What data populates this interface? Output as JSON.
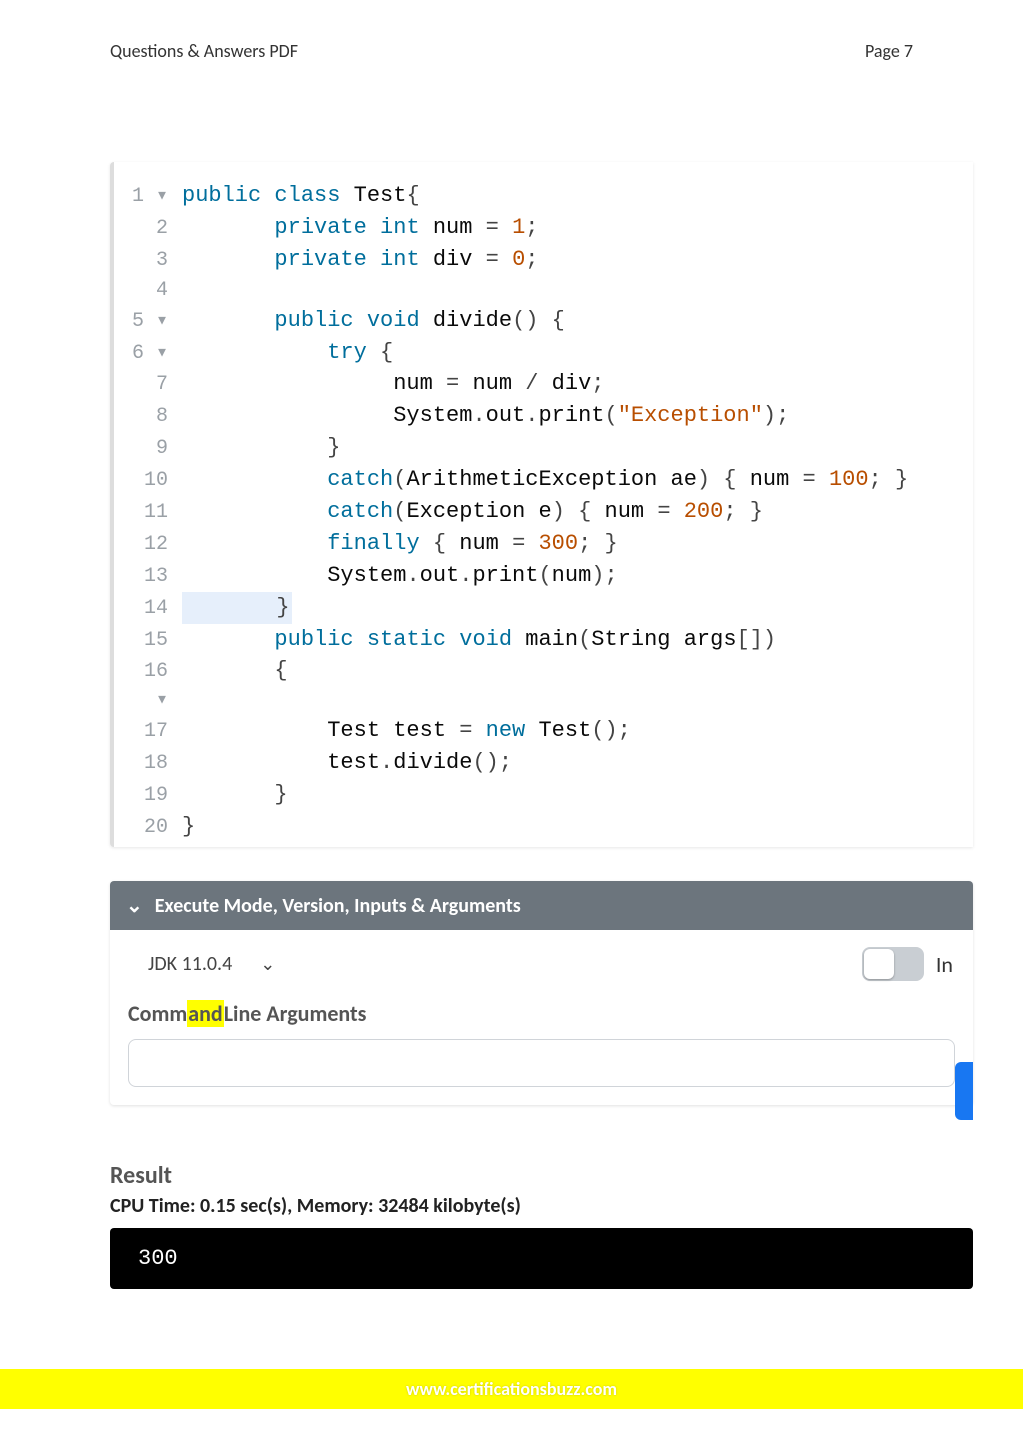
{
  "header": {
    "left": "Questions & Answers PDF",
    "right": "Page 7"
  },
  "code": {
    "lines": [
      {
        "ln": "1",
        "marker": "▾",
        "tokens": [
          [
            "k",
            "public "
          ],
          [
            "k",
            "class "
          ],
          [
            "nm",
            "Test"
          ],
          [
            "pn",
            "{"
          ]
        ]
      },
      {
        "ln": "2",
        "marker": "",
        "tokens": [
          [
            "nm",
            "       "
          ],
          [
            "k",
            "private "
          ],
          [
            "ty",
            "int "
          ],
          [
            "nm",
            "num "
          ],
          [
            "pn",
            "= "
          ],
          [
            "num",
            "1"
          ],
          [
            "pn",
            ";"
          ]
        ]
      },
      {
        "ln": "3",
        "marker": "",
        "tokens": [
          [
            "nm",
            "       "
          ],
          [
            "k",
            "private "
          ],
          [
            "ty",
            "int "
          ],
          [
            "nm",
            "div "
          ],
          [
            "pn",
            "= "
          ],
          [
            "num",
            "0"
          ],
          [
            "pn",
            ";"
          ]
        ]
      },
      {
        "ln": "4",
        "marker": "",
        "tokens": [
          [
            "nm",
            ""
          ]
        ]
      },
      {
        "ln": "5",
        "marker": "▾",
        "tokens": [
          [
            "nm",
            "       "
          ],
          [
            "k",
            "public "
          ],
          [
            "ty",
            "void "
          ],
          [
            "nm",
            "divide"
          ],
          [
            "pn",
            "() {"
          ]
        ]
      },
      {
        "ln": "6",
        "marker": "▾",
        "tokens": [
          [
            "nm",
            "           "
          ],
          [
            "k",
            "try "
          ],
          [
            "pn",
            "{"
          ]
        ]
      },
      {
        "ln": "7",
        "marker": "",
        "tokens": [
          [
            "nm",
            "                num "
          ],
          [
            "pn",
            "= "
          ],
          [
            "nm",
            "num "
          ],
          [
            "pn",
            "/ "
          ],
          [
            "nm",
            "div"
          ],
          [
            "pn",
            ";"
          ]
        ]
      },
      {
        "ln": "8",
        "marker": "",
        "tokens": [
          [
            "nm",
            "                System"
          ],
          [
            "pn",
            "."
          ],
          [
            "nm",
            "out"
          ],
          [
            "pn",
            "."
          ],
          [
            "nm",
            "print"
          ],
          [
            "pn",
            "("
          ],
          [
            "str",
            "\"Exception\""
          ],
          [
            "pn",
            ");"
          ]
        ]
      },
      {
        "ln": "9",
        "marker": "",
        "tokens": [
          [
            "nm",
            "           "
          ],
          [
            "pn",
            "}"
          ]
        ]
      },
      {
        "ln": "10",
        "marker": "",
        "tokens": [
          [
            "nm",
            "           "
          ],
          [
            "k",
            "catch"
          ],
          [
            "pn",
            "("
          ],
          [
            "nm",
            "ArithmeticException ae"
          ],
          [
            "pn",
            ") { "
          ],
          [
            "nm",
            "num "
          ],
          [
            "pn",
            "= "
          ],
          [
            "num",
            "100"
          ],
          [
            "pn",
            "; }"
          ]
        ]
      },
      {
        "ln": "11",
        "marker": "",
        "tokens": [
          [
            "nm",
            "           "
          ],
          [
            "k",
            "catch"
          ],
          [
            "pn",
            "("
          ],
          [
            "nm",
            "Exception e"
          ],
          [
            "pn",
            ") { "
          ],
          [
            "nm",
            "num "
          ],
          [
            "pn",
            "= "
          ],
          [
            "num",
            "200"
          ],
          [
            "pn",
            "; }"
          ]
        ]
      },
      {
        "ln": "12",
        "marker": "",
        "tokens": [
          [
            "nm",
            "           "
          ],
          [
            "k",
            "finally "
          ],
          [
            "pn",
            "{ "
          ],
          [
            "nm",
            "num "
          ],
          [
            "pn",
            "= "
          ],
          [
            "num",
            "300"
          ],
          [
            "pn",
            "; }"
          ]
        ]
      },
      {
        "ln": "13",
        "marker": "",
        "tokens": [
          [
            "nm",
            "           System"
          ],
          [
            "pn",
            "."
          ],
          [
            "nm",
            "out"
          ],
          [
            "pn",
            "."
          ],
          [
            "nm",
            "print"
          ],
          [
            "pn",
            "("
          ],
          [
            "nm",
            "num"
          ],
          [
            "pn",
            ");"
          ]
        ]
      },
      {
        "ln": "14",
        "marker": "",
        "tokens": [
          [
            "nm",
            "       "
          ],
          [
            "pn",
            "}"
          ]
        ],
        "hl": true
      },
      {
        "ln": "15",
        "marker": "",
        "tokens": [
          [
            "nm",
            "       "
          ],
          [
            "k",
            "public "
          ],
          [
            "k",
            "static "
          ],
          [
            "ty",
            "void "
          ],
          [
            "nm",
            "main"
          ],
          [
            "pn",
            "("
          ],
          [
            "nm",
            "String args"
          ],
          [
            "pn",
            "[])"
          ]
        ]
      },
      {
        "ln": "16",
        "marker": "▾",
        "tokens": [
          [
            "nm",
            "       "
          ],
          [
            "pn",
            "{"
          ]
        ]
      },
      {
        "ln": "17",
        "marker": "",
        "tokens": [
          [
            "nm",
            "           Test test "
          ],
          [
            "pn",
            "= "
          ],
          [
            "k",
            "new "
          ],
          [
            "nm",
            "Test"
          ],
          [
            "pn",
            "();"
          ]
        ]
      },
      {
        "ln": "18",
        "marker": "",
        "tokens": [
          [
            "nm",
            "           test"
          ],
          [
            "pn",
            "."
          ],
          [
            "nm",
            "divide"
          ],
          [
            "pn",
            "();"
          ]
        ]
      },
      {
        "ln": "19",
        "marker": "",
        "tokens": [
          [
            "nm",
            "       "
          ],
          [
            "pn",
            "}"
          ]
        ]
      },
      {
        "ln": "20",
        "marker": "",
        "tokens": [
          [
            "pn",
            "}"
          ]
        ],
        "hlend": true
      }
    ]
  },
  "settings": {
    "title": "Execute Mode, Version, Inputs & Arguments",
    "jdk": "JDK 11.0.4",
    "toggleLabel": "In",
    "cmdPrefix": "Comm",
    "cmdHighlight": "and",
    "cmdSuffix": "Line Arguments"
  },
  "result": {
    "title": "Result",
    "cpuLine": "CPU Time: 0.15 sec(s), Memory: 32484 kilobyte(s)",
    "output": "300"
  },
  "footer": {
    "url": "www.certificationsbuzz.com"
  }
}
